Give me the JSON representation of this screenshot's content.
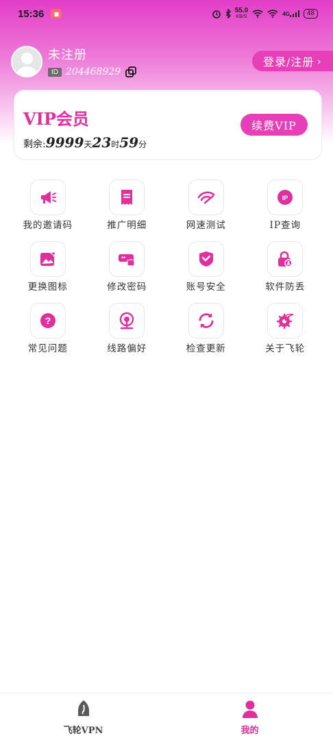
{
  "colors": {
    "accent": "#e63fb8",
    "accent_dark": "#e0309f",
    "gradient_top": "#e23dc8"
  },
  "status_bar": {
    "time": "15:36",
    "network_speed_value": "55.0",
    "network_speed_unit": "KB/S",
    "signal_label": "4G",
    "battery": "48"
  },
  "profile": {
    "username": "未注册",
    "id_tag": "ID",
    "id_value": "204468929",
    "login_button": "登录/注册"
  },
  "vip": {
    "title": "VIP会员",
    "remaining_label": "剩余:",
    "days": "9999",
    "days_unit": "天",
    "hours": "23",
    "hours_unit": "时",
    "minutes": "59",
    "minutes_unit": "分",
    "renew_button": "续费VIP"
  },
  "grid": [
    {
      "label": "我的邀请码",
      "icon": "megaphone-icon"
    },
    {
      "label": "推广明细",
      "icon": "receipt-icon"
    },
    {
      "label": "网速测试",
      "icon": "speed-icon"
    },
    {
      "label": "IP查询",
      "icon": "ip-pin-icon"
    },
    {
      "label": "更换图标",
      "icon": "image-icon"
    },
    {
      "label": "修改密码",
      "icon": "password-icon"
    },
    {
      "label": "账号安全",
      "icon": "shield-check-icon"
    },
    {
      "label": "软件防丢",
      "icon": "lock-user-icon"
    },
    {
      "label": "常见问题",
      "icon": "question-icon"
    },
    {
      "label": "线路偏好",
      "icon": "route-icon"
    },
    {
      "label": "检查更新",
      "icon": "refresh-icon"
    },
    {
      "label": "关于飞轮",
      "icon": "about-gear-icon"
    }
  ],
  "nav": [
    {
      "label": "飞轮VPN",
      "icon": "rocket-icon",
      "active": false
    },
    {
      "label": "我的",
      "icon": "person-icon",
      "active": true
    }
  ]
}
